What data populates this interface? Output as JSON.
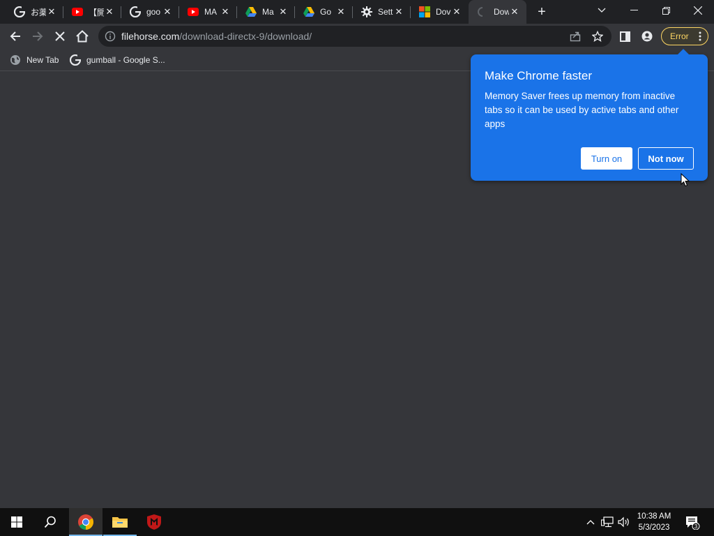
{
  "tabs": [
    {
      "title": "お薬",
      "favicon": "google-g-icon"
    },
    {
      "title": "【開",
      "favicon": "youtube-icon"
    },
    {
      "title": "goo",
      "favicon": "google-g-icon"
    },
    {
      "title": "MA",
      "favicon": "youtube-icon"
    },
    {
      "title": "Ma",
      "favicon": "google-drive-icon"
    },
    {
      "title": "Go",
      "favicon": "google-drive-icon"
    },
    {
      "title": "Sett",
      "favicon": "gear-icon"
    },
    {
      "title": "Dov",
      "favicon": "microsoft-icon"
    },
    {
      "title": "Dow",
      "favicon": "loading-spinner-icon",
      "active": true
    }
  ],
  "omnibox": {
    "host": "filehorse.com",
    "path": "/download-directx-9/download/"
  },
  "profile_error_label": "Error",
  "bookmarks": [
    {
      "label": "New Tab",
      "icon": "globe-icon"
    },
    {
      "label": "gumball - Google S...",
      "icon": "google-g-icon"
    }
  ],
  "popup": {
    "title": "Make Chrome faster",
    "body": "Memory Saver frees up memory from inactive tabs so it can be used by active tabs and other apps",
    "turn_on_label": "Turn on",
    "not_now_label": "Not now"
  },
  "taskbar": {
    "time": "10:38 AM",
    "date": "5/3/2023",
    "notification_count": "3"
  },
  "colors": {
    "popup_bg": "#1a73e8",
    "error_accent": "#fdd663",
    "window_bg": "#35363a",
    "tabstrip_bg": "#202124"
  }
}
